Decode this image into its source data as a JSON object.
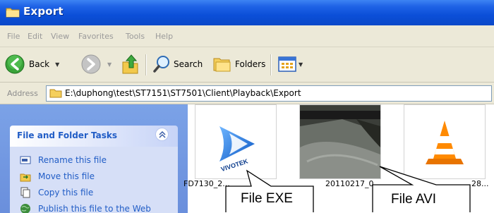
{
  "window": {
    "title": "Export"
  },
  "menu": [
    "File",
    "Edit",
    "View",
    "Favorites",
    "Tools",
    "Help"
  ],
  "toolbar": {
    "back_label": "Back",
    "search_label": "Search",
    "folders_label": "Folders"
  },
  "address": {
    "label": "Address",
    "path": "E:\\duphong\\test\\ST7151\\ST7501\\Client\\Playback\\Export"
  },
  "tasks": {
    "title": "File and Folder Tasks",
    "items": [
      {
        "label": "Rename this file",
        "icon": "rename-icon"
      },
      {
        "label": "Move this file",
        "icon": "move-icon"
      },
      {
        "label": "Copy this file",
        "icon": "copy-icon"
      },
      {
        "label": "Publish this file to the Web",
        "icon": "publish-icon"
      }
    ]
  },
  "files": [
    {
      "name": "FD7130_2...",
      "icon": "vivotek-player-icon",
      "brand": "VIVOTEK"
    },
    {
      "name": "20110217_0...",
      "icon": "video-thumbnail"
    },
    {
      "name": "28...",
      "icon": "vlc-cone-icon"
    }
  ],
  "callouts": [
    {
      "text": "File EXE"
    },
    {
      "text": "File AVI"
    }
  ],
  "colors": {
    "titlebar": "#0a48c8",
    "task_text": "#215dc6",
    "side_pane": "#6a8fdc"
  }
}
